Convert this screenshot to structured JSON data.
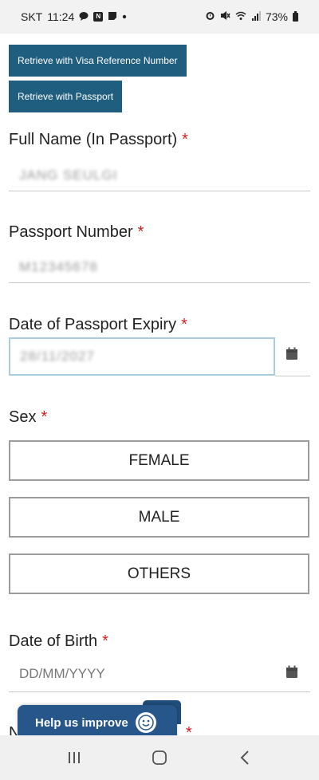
{
  "status_bar": {
    "carrier": "SKT",
    "time": "11:24",
    "battery": "73%"
  },
  "form": {
    "retrieve_visa_label": "Retrieve with Visa Reference Number",
    "retrieve_passport_label": "Retrieve with Passport",
    "required_mark": "*",
    "full_name": {
      "label": "Full Name (In Passport)",
      "value": "JANG SEULGI"
    },
    "passport_number": {
      "label": "Passport Number",
      "value": "M12345678"
    },
    "passport_expiry": {
      "label": "Date of Passport Expiry",
      "value": "28/11/2027"
    },
    "sex": {
      "label": "Sex",
      "options": [
        "FEMALE",
        "MALE",
        "OTHERS"
      ]
    },
    "date_of_birth": {
      "label": "Date of Birth",
      "placeholder": "DD/MM/YYYY"
    },
    "next_field_partial": "N"
  },
  "feedback": {
    "label": "Help us improve"
  },
  "icons": {
    "chat": "chat-bubble-icon",
    "notes": "notes-icon",
    "calendar": "calendar-icon",
    "smiley": "smiley-icon",
    "recent_apps": "recent-apps-icon",
    "home": "home-icon",
    "back": "back-icon"
  },
  "colors": {
    "primary": "#1f5e7e",
    "required": "#cc1f1f",
    "focus_border": "#a9cde0",
    "feedback": "#27578a"
  }
}
